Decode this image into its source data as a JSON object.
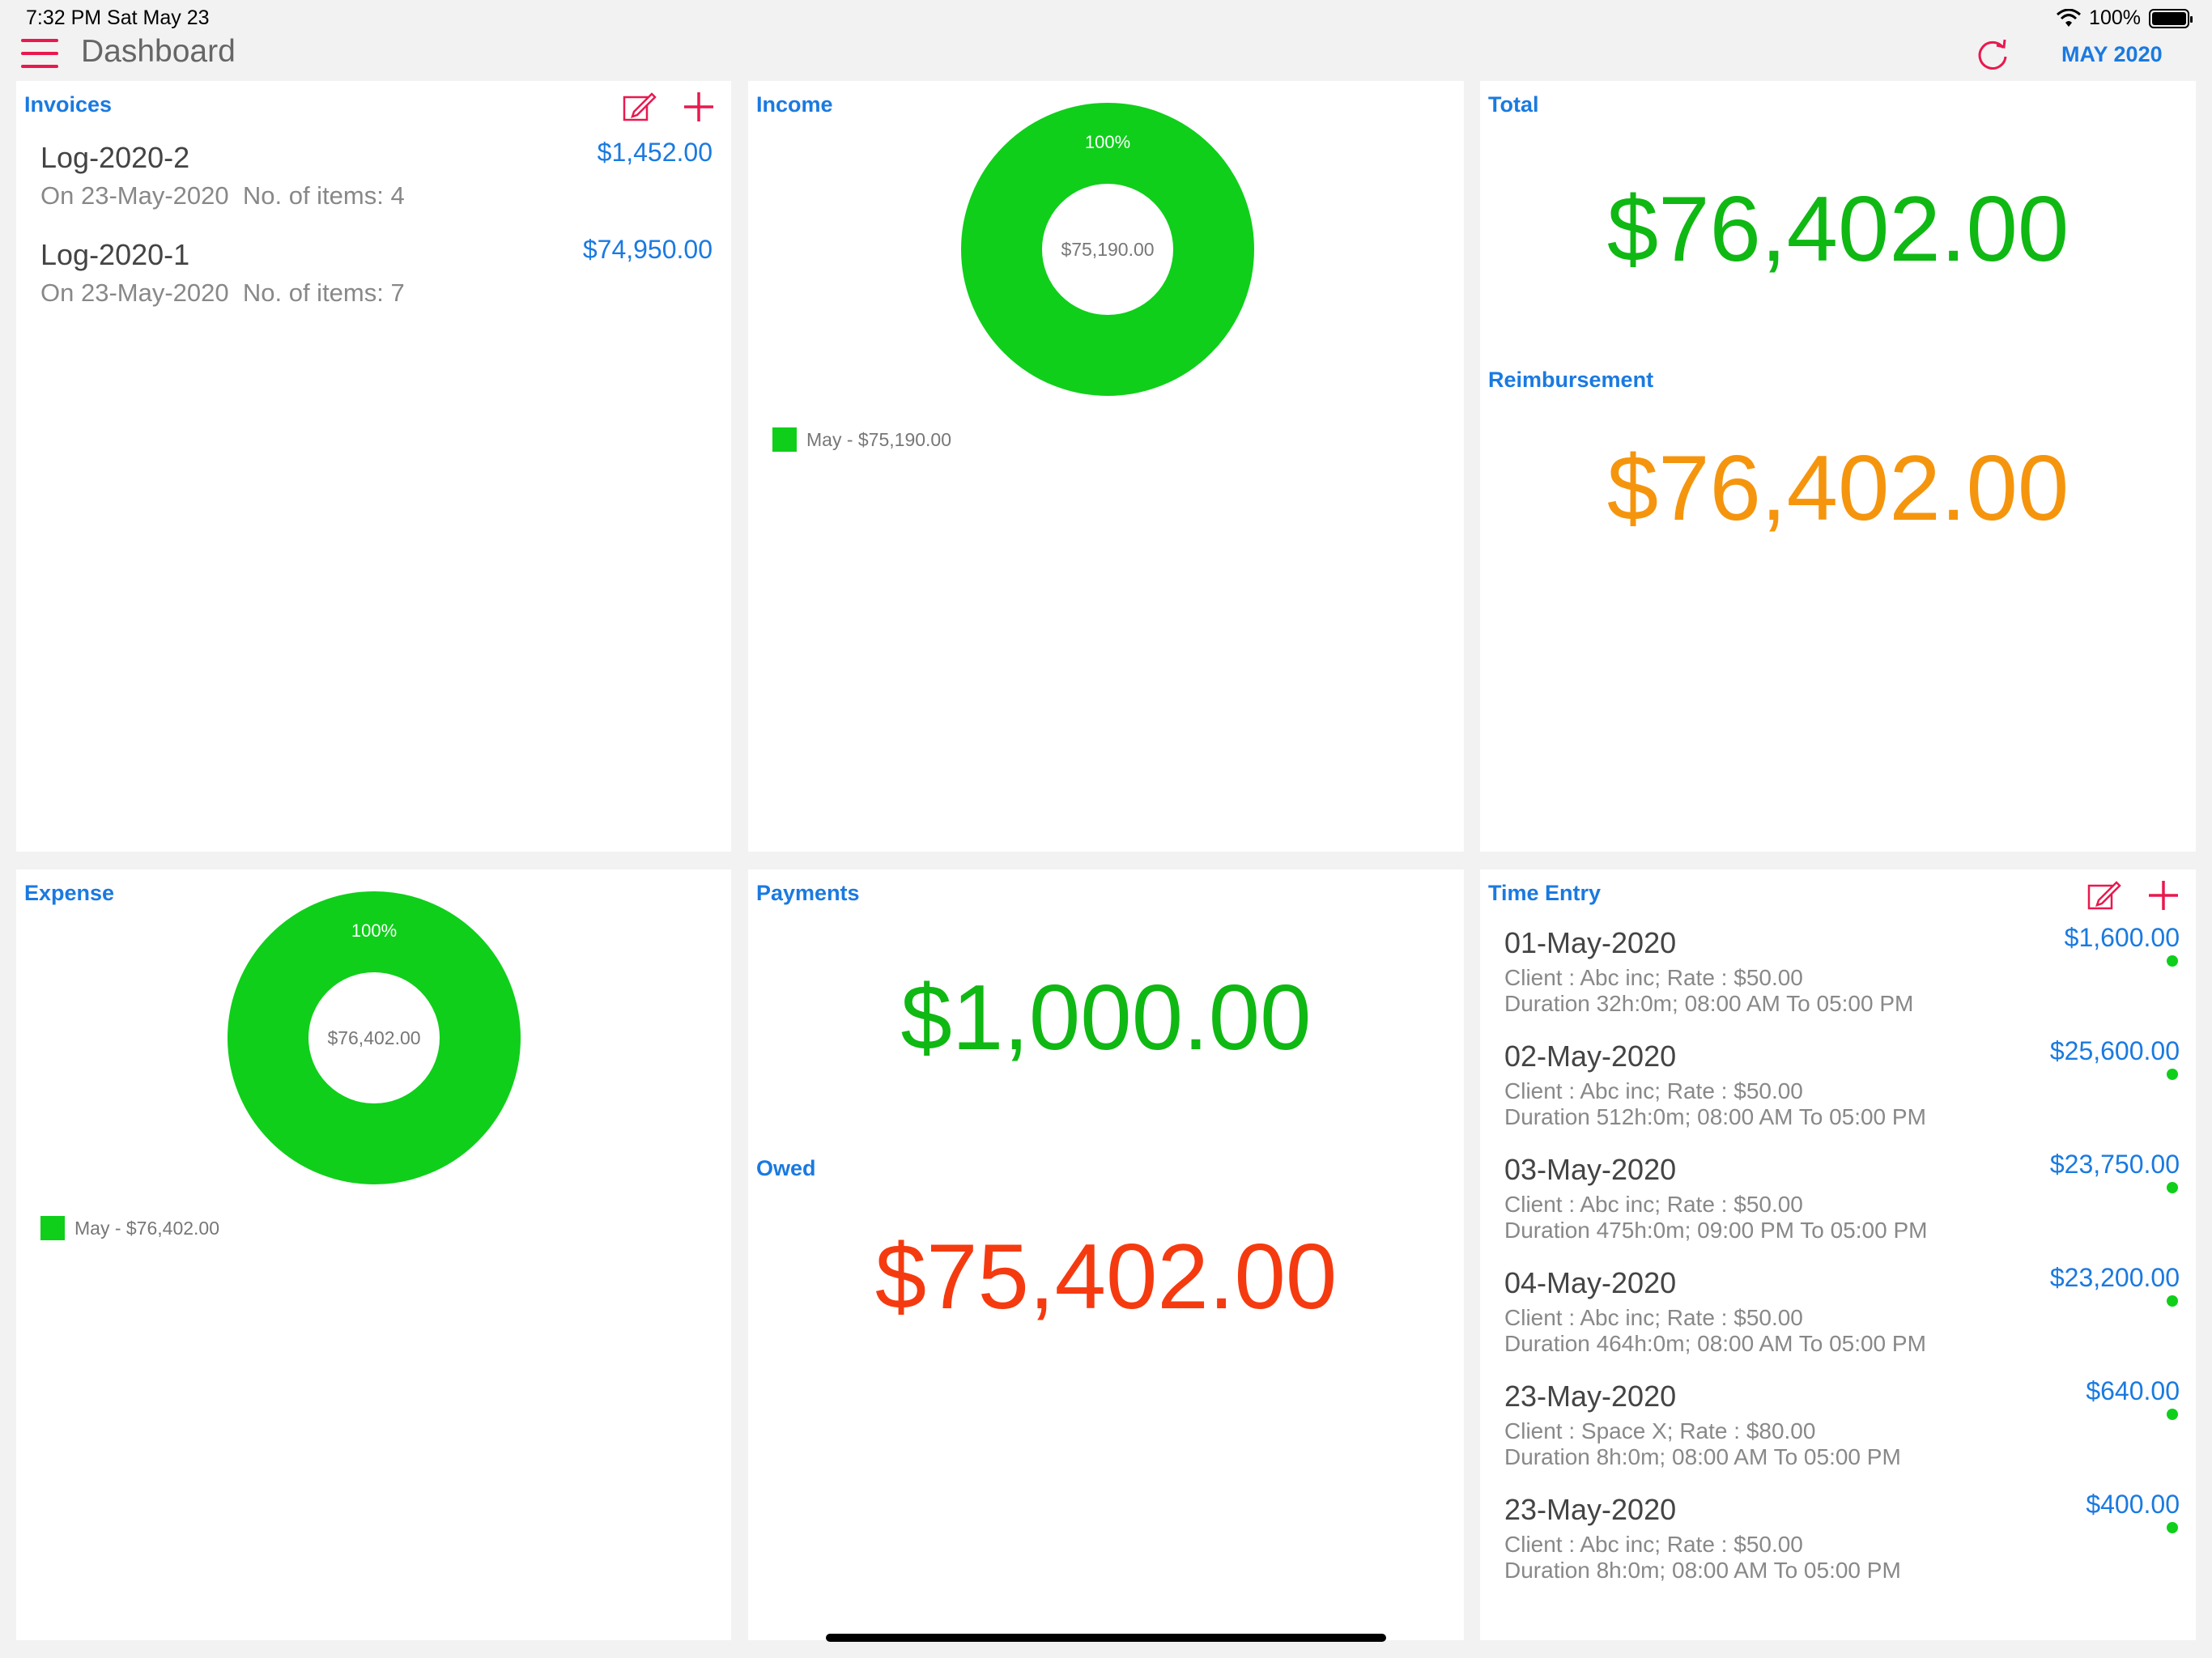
{
  "status_bar": {
    "time": "7:32 PM  Sat May 23",
    "battery_pct": "100%"
  },
  "header": {
    "title": "Dashboard",
    "period": "MAY 2020"
  },
  "colors": {
    "accent": "#1a7ae0",
    "green": "#0fcf1a",
    "orange": "#f5950d",
    "red": "#f53a10",
    "pink": "#e8194e"
  },
  "invoices": {
    "title": "Invoices",
    "items": [
      {
        "name": "Log-2020-2",
        "date": "On 23-May-2020",
        "items": "No. of items: 4",
        "amount": "$1,452.00"
      },
      {
        "name": "Log-2020-1",
        "date": "On 23-May-2020",
        "items": "No. of items: 7",
        "amount": "$74,950.00"
      }
    ]
  },
  "income": {
    "title": "Income",
    "percent": "100%",
    "center": "$75,190.00",
    "legend": "May - $75,190.00"
  },
  "totals": {
    "total_title": "Total",
    "total_value": "$76,402.00",
    "reimb_title": "Reimbursement",
    "reimb_value": "$76,402.00"
  },
  "expense": {
    "title": "Expense",
    "percent": "100%",
    "center": "$76,402.00",
    "legend": "May - $76,402.00"
  },
  "payments": {
    "title": "Payments",
    "value": "$1,000.00",
    "owed_title": "Owed",
    "owed_value": "$75,402.00"
  },
  "time_entry": {
    "title": "Time Entry",
    "items": [
      {
        "date": "01-May-2020",
        "client": "Client : Abc inc; Rate : $50.00",
        "duration": "Duration 32h:0m; 08:00 AM To 05:00 PM",
        "amount": "$1,600.00"
      },
      {
        "date": "02-May-2020",
        "client": "Client : Abc inc; Rate : $50.00",
        "duration": "Duration 512h:0m; 08:00 AM To 05:00 PM",
        "amount": "$25,600.00"
      },
      {
        "date": "03-May-2020",
        "client": "Client : Abc inc; Rate : $50.00",
        "duration": "Duration 475h:0m; 09:00 PM To 05:00 PM",
        "amount": "$23,750.00"
      },
      {
        "date": "04-May-2020",
        "client": "Client : Abc inc; Rate : $50.00",
        "duration": "Duration 464h:0m; 08:00 AM To 05:00 PM",
        "amount": "$23,200.00"
      },
      {
        "date": "23-May-2020",
        "client": "Client : Space X; Rate : $80.00",
        "duration": "Duration 8h:0m; 08:00 AM To 05:00 PM",
        "amount": "$640.00"
      },
      {
        "date": "23-May-2020",
        "client": "Client : Abc inc; Rate : $50.00",
        "duration": "Duration 8h:0m; 08:00 AM To 05:00 PM",
        "amount": "$400.00"
      }
    ]
  }
}
